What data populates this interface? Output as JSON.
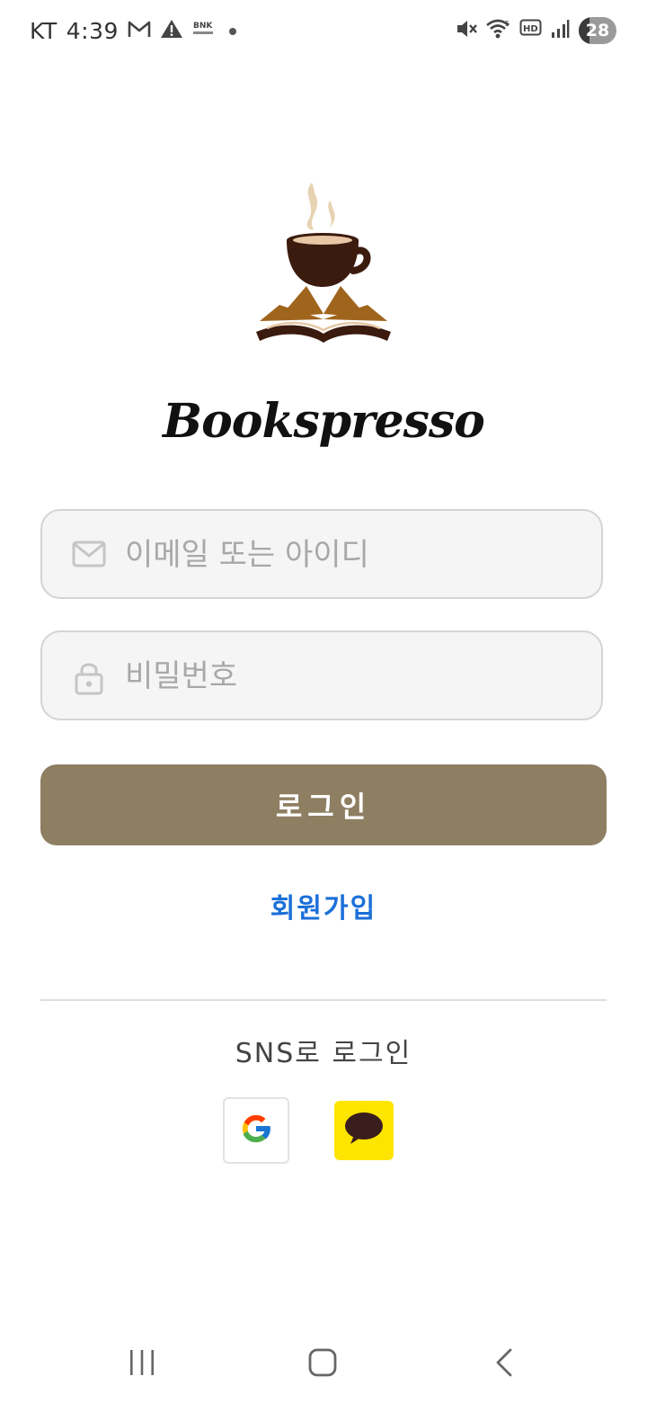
{
  "status_bar": {
    "carrier": "KT",
    "time": "4:39",
    "battery": "28",
    "battery_level": 0.28,
    "left_icons": [
      "gmail-icon",
      "warning-icon",
      "bnk-bank-icon",
      "notification-dot-icon"
    ],
    "right_icons": [
      "mute-icon",
      "wifi-icon",
      "hd-voice-icon",
      "signal-icon",
      "battery-icon"
    ]
  },
  "app": {
    "title": "Bookspresso",
    "logo_icon": "coffee-book-logo-icon"
  },
  "login": {
    "email_placeholder": "이메일 또는 아이디",
    "email_value": "",
    "email_icon": "mail-icon",
    "password_placeholder": "비밀번호",
    "password_value": "",
    "password_icon": "lock-icon",
    "login_label": "로그인",
    "signup_label": "회원가입"
  },
  "sns": {
    "label": "SNS로 로그인",
    "providers": [
      {
        "name": "google",
        "icon": "google-icon"
      },
      {
        "name": "kakao",
        "icon": "kakao-icon"
      }
    ]
  },
  "nav_bar": {
    "buttons": [
      "recents-icon",
      "home-icon",
      "back-icon"
    ]
  },
  "colors": {
    "primary_button": "#8e7e62",
    "link": "#1b6fd8",
    "field_bg": "#f5f5f5",
    "field_border": "#d4d4d4",
    "kakao_yellow": "#fee500",
    "coffee_dark": "#3b1b0e",
    "book_brown": "#a0651d"
  }
}
